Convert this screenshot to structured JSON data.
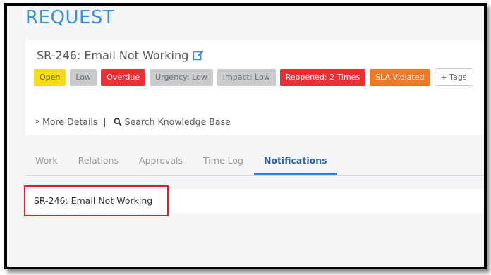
{
  "page": {
    "title": "REQUEST"
  },
  "request": {
    "title": "SR-246: Email Not Working",
    "tags": [
      {
        "label": "Open",
        "style": "open",
        "color": "#f7de12"
      },
      {
        "label": "Low",
        "style": "gray",
        "color": "#c9cbcd"
      },
      {
        "label": "Overdue",
        "style": "red",
        "color": "#ec2f34"
      },
      {
        "label": "Urgency: Low",
        "style": "gray",
        "color": "#c9cbcd"
      },
      {
        "label": "Impact: Low",
        "style": "gray",
        "color": "#c9cbcd"
      },
      {
        "label": "Reopened: 2 Times",
        "style": "red",
        "color": "#ec2f34"
      },
      {
        "label": "SLA Violated",
        "style": "orange",
        "color": "#ec7a29"
      }
    ],
    "add_tag_label": "+ Tags",
    "more_details_label": "More Details",
    "separator": "|",
    "search_kb_label": "Search Knowledge Base"
  },
  "tabs": [
    {
      "label": "Work",
      "active": false
    },
    {
      "label": "Relations",
      "active": false
    },
    {
      "label": "Approvals",
      "active": false
    },
    {
      "label": "Time Log",
      "active": false
    },
    {
      "label": "Notifications",
      "active": true
    }
  ],
  "notifications": {
    "item_text": "SR-246: Email Not Working"
  },
  "colors": {
    "accent": "#3d8fd8",
    "active_tab": "#2c5ea8",
    "highlight_border": "#e02020"
  },
  "icons": {
    "edit": "edit-icon",
    "more": "double-chevron-down-icon",
    "search": "search-icon"
  }
}
